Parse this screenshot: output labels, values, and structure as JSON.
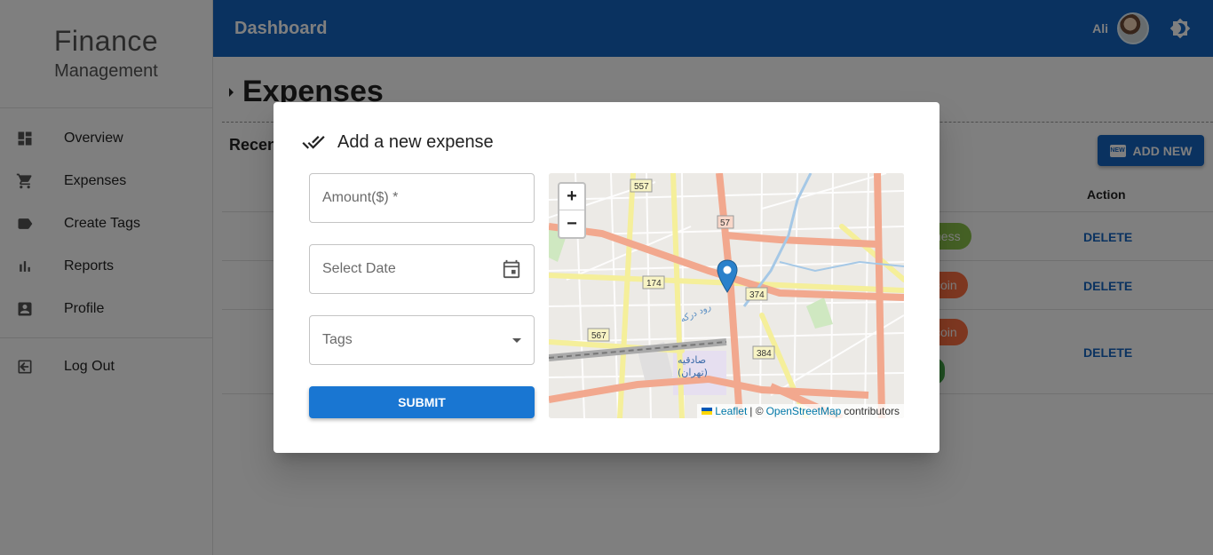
{
  "sidebar": {
    "brand_line1": "Finance",
    "brand_line2": "Management",
    "items": [
      {
        "label": "Overview",
        "icon": "dashboard-icon"
      },
      {
        "label": "Expenses",
        "icon": "cart-icon"
      },
      {
        "label": "Create Tags",
        "icon": "tag-icon"
      },
      {
        "label": "Reports",
        "icon": "bar-chart-icon"
      },
      {
        "label": "Profile",
        "icon": "account-box-icon"
      }
    ],
    "logout_label": "Log Out"
  },
  "header": {
    "title": "Dashboard",
    "user_name": "Ali",
    "theme_icon": "brightness-icon",
    "color": "#1565c0"
  },
  "main": {
    "heading": "Expenses",
    "recent_title": "Recen",
    "add_new_label": "ADD NEW",
    "add_new_icon_text": "NEW",
    "action_header": "Action",
    "rows": [
      {
        "chip": "ness",
        "chip_color": "#8bc34a",
        "delete": "DELETE"
      },
      {
        "chip": "coin",
        "chip_color": "#ff7043",
        "delete": "DELETE"
      },
      {
        "chip": "coin",
        "chip_color": "#ff7043",
        "delete": "DELETE"
      }
    ]
  },
  "dialog": {
    "title": "Add a new expense",
    "amount_placeholder": "Amount($) *",
    "date_placeholder": "Select Date",
    "tags_placeholder": "Tags",
    "submit_label": "SUBMIT",
    "map": {
      "zoom_in": "+",
      "zoom_out": "−",
      "attribution_leaflet": "Leaflet",
      "attribution_sep": "| ©",
      "attribution_osm": "OpenStreetMap",
      "attribution_suffix": "contributors",
      "road_labels": [
        "557",
        "57",
        "174",
        "374",
        "567",
        "384"
      ],
      "place_labels": [
        "صادقیه",
        "(تهران)",
        "رود درکه"
      ]
    }
  }
}
